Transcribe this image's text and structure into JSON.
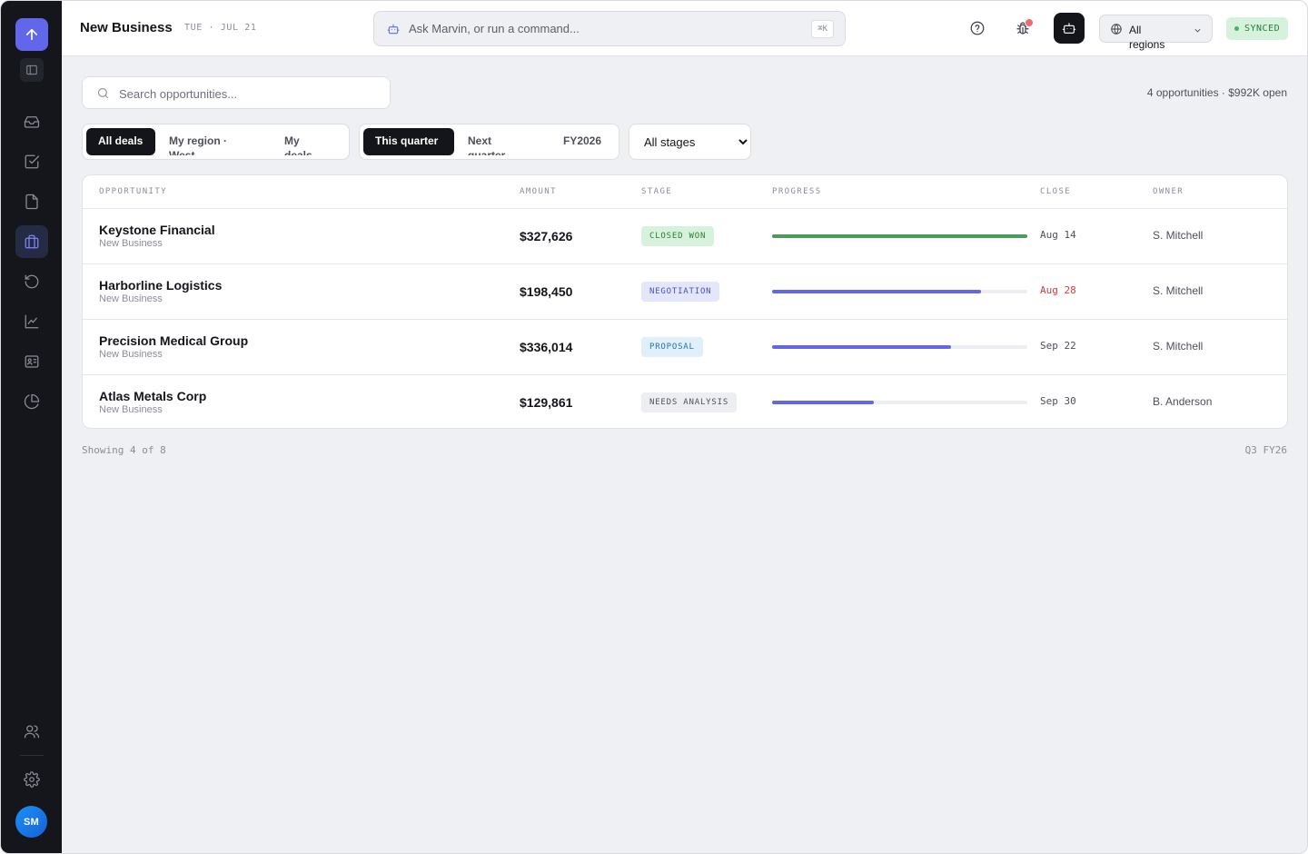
{
  "app": {
    "title": "New Business",
    "date": "TUE · JUL 21"
  },
  "sidebar": {
    "avatar_initials": "SM",
    "items": [
      {
        "icon": "inbox-icon",
        "label": "Inbox"
      },
      {
        "icon": "tasks-icon",
        "label": "Tasks"
      },
      {
        "icon": "document-icon",
        "label": "Documents"
      },
      {
        "icon": "briefcase-icon",
        "label": "Opportunities",
        "active": true
      },
      {
        "icon": "history-icon",
        "label": "History"
      },
      {
        "icon": "chart-icon",
        "label": "Analytics"
      },
      {
        "icon": "contact-card-icon",
        "label": "Contacts"
      },
      {
        "icon": "pie-chart-icon",
        "label": "Reports"
      }
    ]
  },
  "header": {
    "command_placeholder": "Ask Marvin, or run a command...",
    "command_shortcut": "⌘K",
    "region_label": "All regions",
    "sync_status": "SYNCED",
    "colors": {
      "accent": "#6266ea",
      "sync_bg": "#d6f2dc",
      "sync_text": "#2b7a3c"
    }
  },
  "toolbar": {
    "search_placeholder": "Search opportunities...",
    "summary": "4 opportunities · $992K open",
    "scope_options": [
      "All deals",
      "My region · West",
      "My deals"
    ],
    "scope_selected": "All deals",
    "period_options": [
      "This quarter",
      "Next quarter",
      "FY2026"
    ],
    "period_selected": "This quarter",
    "stage_options": [
      "All stages"
    ],
    "stage_selected": "All stages"
  },
  "table": {
    "columns": [
      "OPPORTUNITY",
      "AMOUNT",
      "STAGE",
      "PROGRESS",
      "CLOSE",
      "OWNER"
    ],
    "rows": [
      {
        "name": "Keystone Financial",
        "segment": "New Business",
        "amount": "$327,626",
        "stage": "CLOSED WON",
        "stage_bg": "#d6f2dc",
        "stage_color": "#2b7a3c",
        "progress": 1.0,
        "progress_color": "#4a9b57",
        "close": "Aug 14",
        "close_color": "#4d505b",
        "owner": "S. Mitchell"
      },
      {
        "name": "Harborline Logistics",
        "segment": "New Business",
        "amount": "$198,450",
        "stage": "NEGOTIATION",
        "stage_bg": "#e4e6fb",
        "stage_color": "#4b4fc4",
        "progress": 0.82,
        "progress_color": "#6266ea",
        "close": "Aug 28",
        "close_color": "#d23c3c",
        "owner": "S. Mitchell"
      },
      {
        "name": "Precision Medical Group",
        "segment": "New Business",
        "amount": "$336,014",
        "stage": "PROPOSAL",
        "stage_bg": "#dff0fb",
        "stage_color": "#2a6fa8",
        "progress": 0.7,
        "progress_color": "#6266ea",
        "close": "Sep 22",
        "close_color": "#4d505b",
        "owner": "S. Mitchell"
      },
      {
        "name": "Atlas Metals Corp",
        "segment": "New Business",
        "amount": "$129,861",
        "stage": "NEEDS ANALYSIS",
        "stage_bg": "#eceef2",
        "stage_color": "#4d505b",
        "progress": 0.4,
        "progress_color": "#6266ea",
        "close": "Sep 30",
        "close_color": "#4d505b",
        "owner": "B. Anderson"
      }
    ]
  },
  "footer": {
    "showing": "Showing 4 of 8",
    "period": "Q3 FY26"
  }
}
